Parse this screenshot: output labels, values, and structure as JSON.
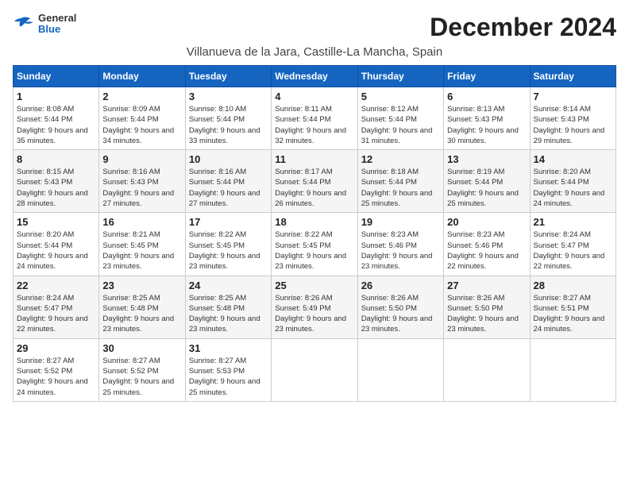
{
  "logo": {
    "line1": "General",
    "line2": "Blue"
  },
  "title": "December 2024",
  "subtitle": "Villanueva de la Jara, Castille-La Mancha, Spain",
  "weekdays": [
    "Sunday",
    "Monday",
    "Tuesday",
    "Wednesday",
    "Thursday",
    "Friday",
    "Saturday"
  ],
  "weeks": [
    [
      {
        "day": "1",
        "sunrise": "8:08 AM",
        "sunset": "5:44 PM",
        "daylight": "9 hours and 35 minutes."
      },
      {
        "day": "2",
        "sunrise": "8:09 AM",
        "sunset": "5:44 PM",
        "daylight": "9 hours and 34 minutes."
      },
      {
        "day": "3",
        "sunrise": "8:10 AM",
        "sunset": "5:44 PM",
        "daylight": "9 hours and 33 minutes."
      },
      {
        "day": "4",
        "sunrise": "8:11 AM",
        "sunset": "5:44 PM",
        "daylight": "9 hours and 32 minutes."
      },
      {
        "day": "5",
        "sunrise": "8:12 AM",
        "sunset": "5:44 PM",
        "daylight": "9 hours and 31 minutes."
      },
      {
        "day": "6",
        "sunrise": "8:13 AM",
        "sunset": "5:43 PM",
        "daylight": "9 hours and 30 minutes."
      },
      {
        "day": "7",
        "sunrise": "8:14 AM",
        "sunset": "5:43 PM",
        "daylight": "9 hours and 29 minutes."
      }
    ],
    [
      {
        "day": "8",
        "sunrise": "8:15 AM",
        "sunset": "5:43 PM",
        "daylight": "9 hours and 28 minutes."
      },
      {
        "day": "9",
        "sunrise": "8:16 AM",
        "sunset": "5:43 PM",
        "daylight": "9 hours and 27 minutes."
      },
      {
        "day": "10",
        "sunrise": "8:16 AM",
        "sunset": "5:44 PM",
        "daylight": "9 hours and 27 minutes."
      },
      {
        "day": "11",
        "sunrise": "8:17 AM",
        "sunset": "5:44 PM",
        "daylight": "9 hours and 26 minutes."
      },
      {
        "day": "12",
        "sunrise": "8:18 AM",
        "sunset": "5:44 PM",
        "daylight": "9 hours and 25 minutes."
      },
      {
        "day": "13",
        "sunrise": "8:19 AM",
        "sunset": "5:44 PM",
        "daylight": "9 hours and 25 minutes."
      },
      {
        "day": "14",
        "sunrise": "8:20 AM",
        "sunset": "5:44 PM",
        "daylight": "9 hours and 24 minutes."
      }
    ],
    [
      {
        "day": "15",
        "sunrise": "8:20 AM",
        "sunset": "5:44 PM",
        "daylight": "9 hours and 24 minutes."
      },
      {
        "day": "16",
        "sunrise": "8:21 AM",
        "sunset": "5:45 PM",
        "daylight": "9 hours and 23 minutes."
      },
      {
        "day": "17",
        "sunrise": "8:22 AM",
        "sunset": "5:45 PM",
        "daylight": "9 hours and 23 minutes."
      },
      {
        "day": "18",
        "sunrise": "8:22 AM",
        "sunset": "5:45 PM",
        "daylight": "9 hours and 23 minutes."
      },
      {
        "day": "19",
        "sunrise": "8:23 AM",
        "sunset": "5:46 PM",
        "daylight": "9 hours and 23 minutes."
      },
      {
        "day": "20",
        "sunrise": "8:23 AM",
        "sunset": "5:46 PM",
        "daylight": "9 hours and 22 minutes."
      },
      {
        "day": "21",
        "sunrise": "8:24 AM",
        "sunset": "5:47 PM",
        "daylight": "9 hours and 22 minutes."
      }
    ],
    [
      {
        "day": "22",
        "sunrise": "8:24 AM",
        "sunset": "5:47 PM",
        "daylight": "9 hours and 22 minutes."
      },
      {
        "day": "23",
        "sunrise": "8:25 AM",
        "sunset": "5:48 PM",
        "daylight": "9 hours and 23 minutes."
      },
      {
        "day": "24",
        "sunrise": "8:25 AM",
        "sunset": "5:48 PM",
        "daylight": "9 hours and 23 minutes."
      },
      {
        "day": "25",
        "sunrise": "8:26 AM",
        "sunset": "5:49 PM",
        "daylight": "9 hours and 23 minutes."
      },
      {
        "day": "26",
        "sunrise": "8:26 AM",
        "sunset": "5:50 PM",
        "daylight": "9 hours and 23 minutes."
      },
      {
        "day": "27",
        "sunrise": "8:26 AM",
        "sunset": "5:50 PM",
        "daylight": "9 hours and 23 minutes."
      },
      {
        "day": "28",
        "sunrise": "8:27 AM",
        "sunset": "5:51 PM",
        "daylight": "9 hours and 24 minutes."
      }
    ],
    [
      {
        "day": "29",
        "sunrise": "8:27 AM",
        "sunset": "5:52 PM",
        "daylight": "9 hours and 24 minutes."
      },
      {
        "day": "30",
        "sunrise": "8:27 AM",
        "sunset": "5:52 PM",
        "daylight": "9 hours and 25 minutes."
      },
      {
        "day": "31",
        "sunrise": "8:27 AM",
        "sunset": "5:53 PM",
        "daylight": "9 hours and 25 minutes."
      },
      null,
      null,
      null,
      null
    ]
  ]
}
